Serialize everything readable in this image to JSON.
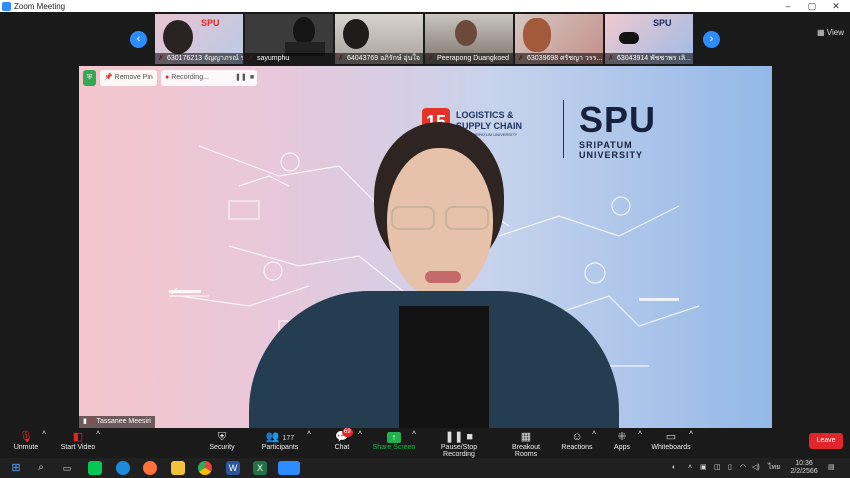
{
  "window": {
    "title": "Zoom Meeting"
  },
  "thumbnails": [
    "630176213 จัญญาภรณ์ ร.ค...",
    "sayumphu",
    "64043769 อภิรักษ์ อุ่นใจ",
    "Peerapong Duangkoed",
    "63039698 ศรัชญา วรร...",
    "63043914 พัชชาพร เลิ..."
  ],
  "view_label": "View",
  "main_video": {
    "remove_pin": "Remove Pin",
    "recording": "Recording...",
    "speaker_name": "Tassanee Meesiri",
    "banner": {
      "line1": "LOGISTICS &",
      "line2": "SUPPLY CHAIN",
      "line3": "SRIPATUM UNIVERSITY",
      "brand": "SPU",
      "brand_sub1": "SRIPATUM",
      "brand_sub2": "UNIVERSITY"
    }
  },
  "toolbar": {
    "unmute": "Unmute",
    "start_video": "Start Video",
    "security": "Security",
    "participants": "Participants",
    "participants_count": "177",
    "chat": "Chat",
    "chat_badge": "69",
    "share_screen": "Share Screen",
    "pause_stop": "Pause/Stop Recording",
    "breakout": "Breakout Rooms",
    "reactions": "Reactions",
    "apps": "Apps",
    "whiteboards": "Whiteboards",
    "leave": "Leave"
  },
  "taskbar": {
    "lang": "ไทย",
    "time": "10:36",
    "date": "2/2/2566"
  },
  "colors": {
    "accent": "#2d8cff",
    "leave": "#e0252b",
    "share": "#22b14c"
  }
}
